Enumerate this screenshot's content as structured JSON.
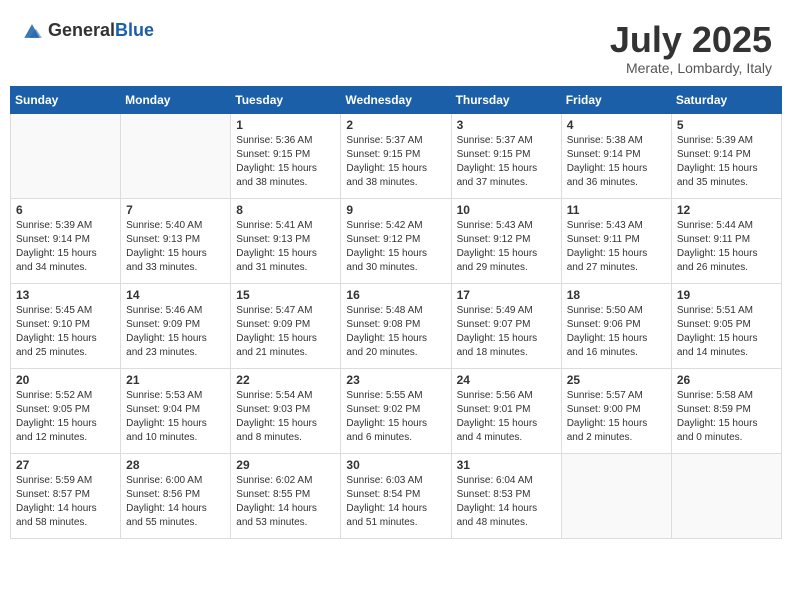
{
  "header": {
    "logo_general": "General",
    "logo_blue": "Blue",
    "month": "July 2025",
    "location": "Merate, Lombardy, Italy"
  },
  "weekdays": [
    "Sunday",
    "Monday",
    "Tuesday",
    "Wednesday",
    "Thursday",
    "Friday",
    "Saturday"
  ],
  "weeks": [
    [
      {
        "day": "",
        "info": ""
      },
      {
        "day": "",
        "info": ""
      },
      {
        "day": "1",
        "info": "Sunrise: 5:36 AM\nSunset: 9:15 PM\nDaylight: 15 hours\nand 38 minutes."
      },
      {
        "day": "2",
        "info": "Sunrise: 5:37 AM\nSunset: 9:15 PM\nDaylight: 15 hours\nand 38 minutes."
      },
      {
        "day": "3",
        "info": "Sunrise: 5:37 AM\nSunset: 9:15 PM\nDaylight: 15 hours\nand 37 minutes."
      },
      {
        "day": "4",
        "info": "Sunrise: 5:38 AM\nSunset: 9:14 PM\nDaylight: 15 hours\nand 36 minutes."
      },
      {
        "day": "5",
        "info": "Sunrise: 5:39 AM\nSunset: 9:14 PM\nDaylight: 15 hours\nand 35 minutes."
      }
    ],
    [
      {
        "day": "6",
        "info": "Sunrise: 5:39 AM\nSunset: 9:14 PM\nDaylight: 15 hours\nand 34 minutes."
      },
      {
        "day": "7",
        "info": "Sunrise: 5:40 AM\nSunset: 9:13 PM\nDaylight: 15 hours\nand 33 minutes."
      },
      {
        "day": "8",
        "info": "Sunrise: 5:41 AM\nSunset: 9:13 PM\nDaylight: 15 hours\nand 31 minutes."
      },
      {
        "day": "9",
        "info": "Sunrise: 5:42 AM\nSunset: 9:12 PM\nDaylight: 15 hours\nand 30 minutes."
      },
      {
        "day": "10",
        "info": "Sunrise: 5:43 AM\nSunset: 9:12 PM\nDaylight: 15 hours\nand 29 minutes."
      },
      {
        "day": "11",
        "info": "Sunrise: 5:43 AM\nSunset: 9:11 PM\nDaylight: 15 hours\nand 27 minutes."
      },
      {
        "day": "12",
        "info": "Sunrise: 5:44 AM\nSunset: 9:11 PM\nDaylight: 15 hours\nand 26 minutes."
      }
    ],
    [
      {
        "day": "13",
        "info": "Sunrise: 5:45 AM\nSunset: 9:10 PM\nDaylight: 15 hours\nand 25 minutes."
      },
      {
        "day": "14",
        "info": "Sunrise: 5:46 AM\nSunset: 9:09 PM\nDaylight: 15 hours\nand 23 minutes."
      },
      {
        "day": "15",
        "info": "Sunrise: 5:47 AM\nSunset: 9:09 PM\nDaylight: 15 hours\nand 21 minutes."
      },
      {
        "day": "16",
        "info": "Sunrise: 5:48 AM\nSunset: 9:08 PM\nDaylight: 15 hours\nand 20 minutes."
      },
      {
        "day": "17",
        "info": "Sunrise: 5:49 AM\nSunset: 9:07 PM\nDaylight: 15 hours\nand 18 minutes."
      },
      {
        "day": "18",
        "info": "Sunrise: 5:50 AM\nSunset: 9:06 PM\nDaylight: 15 hours\nand 16 minutes."
      },
      {
        "day": "19",
        "info": "Sunrise: 5:51 AM\nSunset: 9:05 PM\nDaylight: 15 hours\nand 14 minutes."
      }
    ],
    [
      {
        "day": "20",
        "info": "Sunrise: 5:52 AM\nSunset: 9:05 PM\nDaylight: 15 hours\nand 12 minutes."
      },
      {
        "day": "21",
        "info": "Sunrise: 5:53 AM\nSunset: 9:04 PM\nDaylight: 15 hours\nand 10 minutes."
      },
      {
        "day": "22",
        "info": "Sunrise: 5:54 AM\nSunset: 9:03 PM\nDaylight: 15 hours\nand 8 minutes."
      },
      {
        "day": "23",
        "info": "Sunrise: 5:55 AM\nSunset: 9:02 PM\nDaylight: 15 hours\nand 6 minutes."
      },
      {
        "day": "24",
        "info": "Sunrise: 5:56 AM\nSunset: 9:01 PM\nDaylight: 15 hours\nand 4 minutes."
      },
      {
        "day": "25",
        "info": "Sunrise: 5:57 AM\nSunset: 9:00 PM\nDaylight: 15 hours\nand 2 minutes."
      },
      {
        "day": "26",
        "info": "Sunrise: 5:58 AM\nSunset: 8:59 PM\nDaylight: 15 hours\nand 0 minutes."
      }
    ],
    [
      {
        "day": "27",
        "info": "Sunrise: 5:59 AM\nSunset: 8:57 PM\nDaylight: 14 hours\nand 58 minutes."
      },
      {
        "day": "28",
        "info": "Sunrise: 6:00 AM\nSunset: 8:56 PM\nDaylight: 14 hours\nand 55 minutes."
      },
      {
        "day": "29",
        "info": "Sunrise: 6:02 AM\nSunset: 8:55 PM\nDaylight: 14 hours\nand 53 minutes."
      },
      {
        "day": "30",
        "info": "Sunrise: 6:03 AM\nSunset: 8:54 PM\nDaylight: 14 hours\nand 51 minutes."
      },
      {
        "day": "31",
        "info": "Sunrise: 6:04 AM\nSunset: 8:53 PM\nDaylight: 14 hours\nand 48 minutes."
      },
      {
        "day": "",
        "info": ""
      },
      {
        "day": "",
        "info": ""
      }
    ]
  ]
}
